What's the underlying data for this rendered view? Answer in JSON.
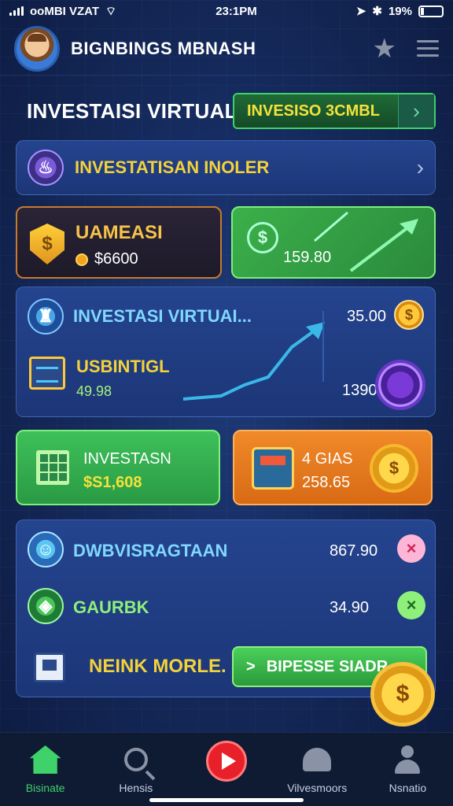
{
  "status_bar": {
    "carrier": "ooMBI VZAT",
    "time": "23:1PM",
    "battery": "19%"
  },
  "header": {
    "title": "BIGNBINGS MBNASH",
    "icons": [
      "avatar",
      "star-icon",
      "menu-icon"
    ]
  },
  "title_row": {
    "page_title": "INVESTAISI VIRTUAL.",
    "invest_button": "INVESISO 3CMBL",
    "arrow": "›"
  },
  "card_list": {
    "label": "INVESTATISAN INOLER",
    "chevron": "›"
  },
  "card_asset": {
    "title": "UAMEASI",
    "value": "$6600",
    "shield_symbol": "$"
  },
  "card_green_value": {
    "symbol": "$",
    "value": "159.80"
  },
  "card_virtual": {
    "title": "INVESTASI VIRTUAI...",
    "value1": "35.00",
    "coin1_symbol": "$",
    "sub_title": "USBINTIGL",
    "sub_value": "49.98",
    "value2": "1390"
  },
  "card_investasn": {
    "title": "INVESTASN",
    "value": "$S1,608"
  },
  "card_gias": {
    "title": "4 GIAS",
    "value": "258.65",
    "coin_symbol": "$"
  },
  "card_bottom": {
    "rows": [
      {
        "label": "DWBVISRAGTAAN",
        "value": "867.90",
        "badge": "×"
      },
      {
        "label": "GAURBK",
        "value": "34.90",
        "badge": "×"
      }
    ],
    "footer_label": "NEINK MORLE.",
    "bypass_button": "BIPESSE SIADR",
    "bypass_arrow": ">",
    "medal_symbol": "$"
  },
  "bottom_nav": {
    "items": [
      {
        "label": "Bisinate",
        "icon": "home-icon",
        "active": true
      },
      {
        "label": "Hensis",
        "icon": "search-icon",
        "active": false
      },
      {
        "label": "",
        "icon": "play-icon",
        "active": false
      },
      {
        "label": "Vilvesmoors",
        "icon": "helmet-icon",
        "active": false
      },
      {
        "label": "Nsnatio",
        "icon": "profile-icon",
        "active": false
      }
    ]
  },
  "colors": {
    "accent_green": "#3fd16a",
    "accent_yellow": "#f4d23a",
    "accent_orange": "#f08a2a",
    "background": "#152a5c"
  }
}
